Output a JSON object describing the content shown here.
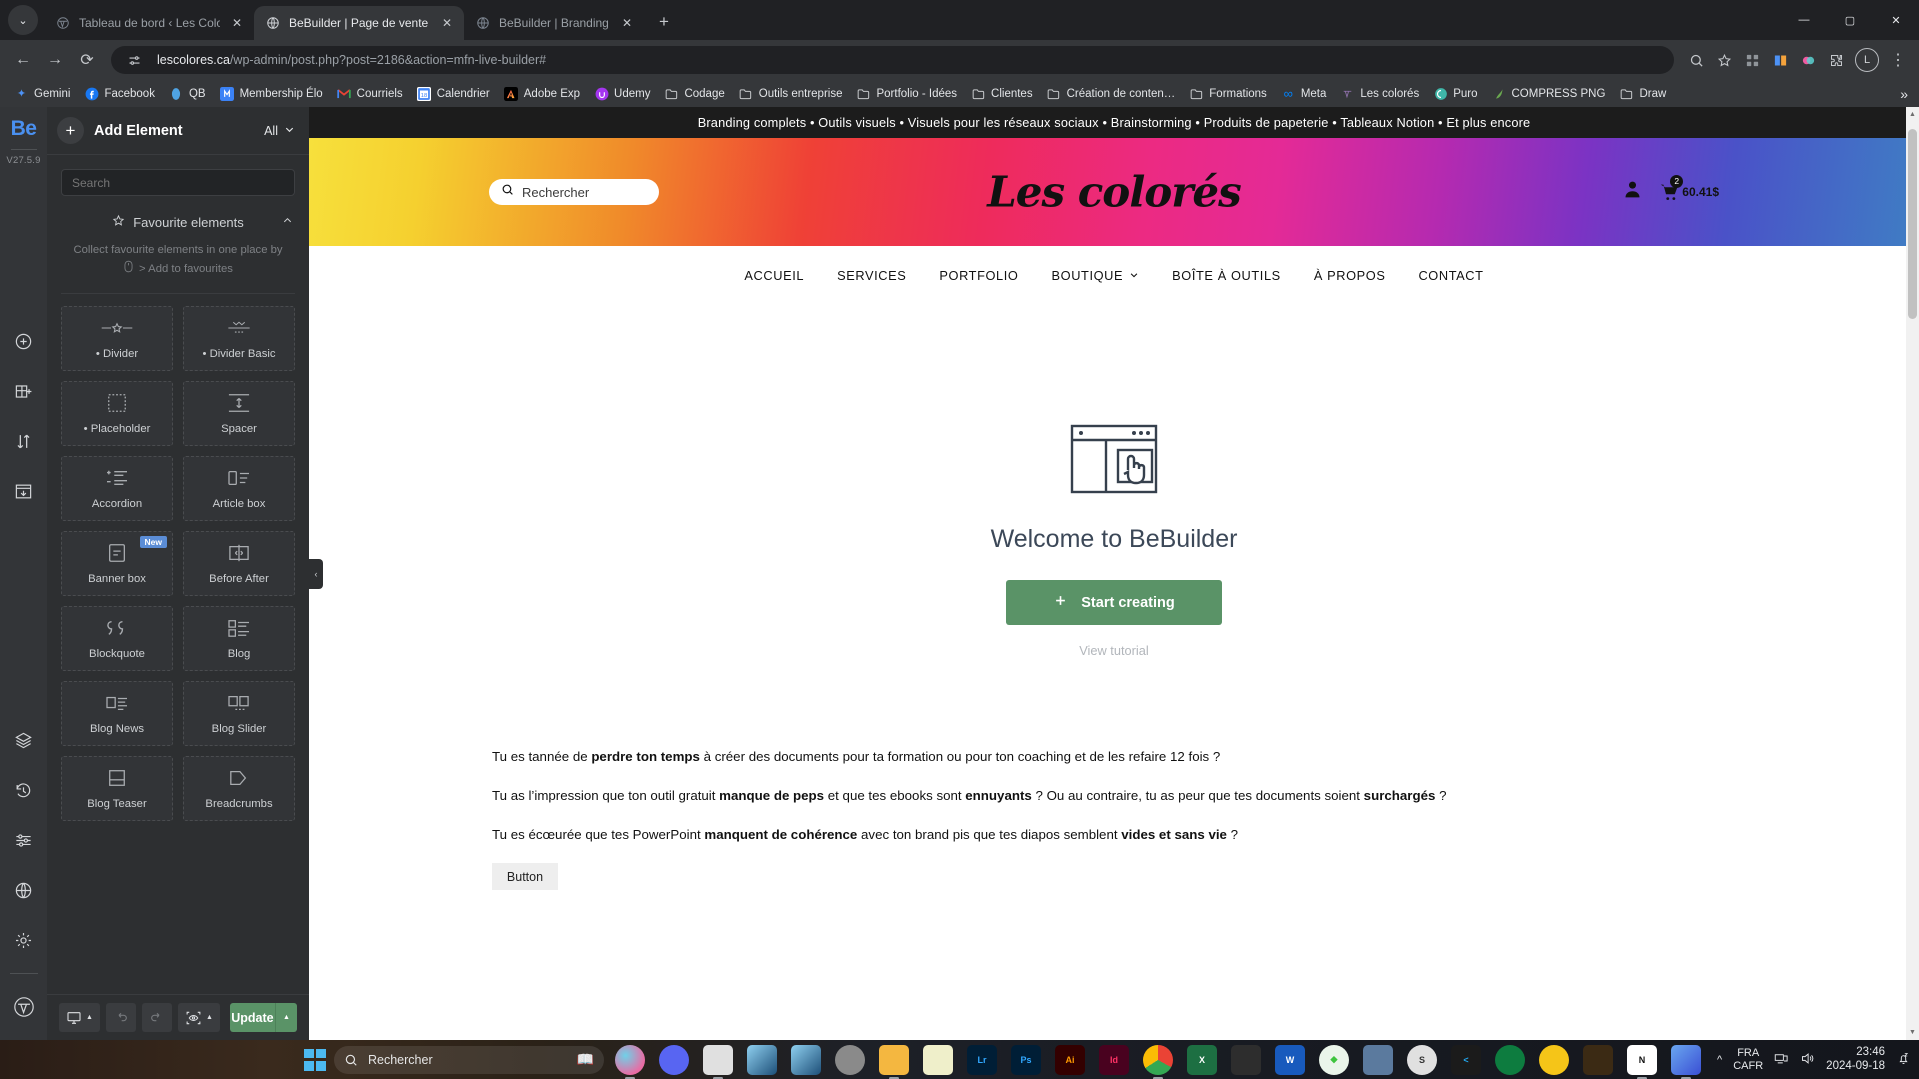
{
  "browser": {
    "tabs": [
      {
        "title": "Tableau de bord ‹ Les Colorés –",
        "favicon": "wordpress-icon",
        "active": false,
        "closable": true
      },
      {
        "title": "BeBuilder | Page de vente – Ou",
        "favicon": "globe-icon",
        "active": true,
        "closable": true
      },
      {
        "title": "BeBuilder | Branding",
        "favicon": "globe-icon",
        "active": false,
        "closable": true
      }
    ],
    "new_tab_label": "+",
    "nav": {
      "back": "←",
      "forward": "→",
      "reload": "⟳"
    },
    "url_domain": "lescolores.ca",
    "url_path": "/wp-admin/post.php?post=2186&action=mfn-live-builder#",
    "profile_initial": "L",
    "window_controls": {
      "minimize": "—",
      "maximize": "▢",
      "close": "✕"
    },
    "bookmarks": [
      {
        "label": "Gemini",
        "icon": "sparkle-icon",
        "color": "#4d92f5"
      },
      {
        "label": "Facebook",
        "icon": "facebook-icon",
        "color": "#1877f2"
      },
      {
        "label": "QB",
        "icon": "quickbooks-icon",
        "color": "#2ca01c"
      },
      {
        "label": "Membership Élo",
        "icon": "membership-icon",
        "color": "#3b82f6"
      },
      {
        "label": "Courriels",
        "icon": "gmail-icon",
        "color": "#ea4335"
      },
      {
        "label": "Calendrier",
        "icon": "calendar-icon",
        "color": "#4285f4"
      },
      {
        "label": "Adobe Exp",
        "icon": "adobe-express-icon",
        "color": "#e0334a"
      },
      {
        "label": "Udemy",
        "icon": "udemy-icon",
        "color": "#a435f0"
      },
      {
        "label": "Codage",
        "icon": "folder-icon",
        "color": "#c8cacd"
      },
      {
        "label": "Outils entreprise",
        "icon": "folder-icon",
        "color": "#c8cacd"
      },
      {
        "label": "Portfolio - Idées",
        "icon": "folder-icon",
        "color": "#c8cacd"
      },
      {
        "label": "Clientes",
        "icon": "folder-icon",
        "color": "#c8cacd"
      },
      {
        "label": "Création de conten…",
        "icon": "folder-icon",
        "color": "#c8cacd"
      },
      {
        "label": "Formations",
        "icon": "folder-icon",
        "color": "#c8cacd"
      },
      {
        "label": "Meta",
        "icon": "meta-icon",
        "color": "#0082fb"
      },
      {
        "label": "Les colorés",
        "icon": "wordpress-icon",
        "color": "#8d6fa8"
      },
      {
        "label": "Puro",
        "icon": "puro-icon",
        "color": "#3fb6a8"
      },
      {
        "label": "COMPRESS PNG",
        "icon": "compress-png-icon",
        "color": "#6aa84f"
      },
      {
        "label": "Draw",
        "icon": "folder-icon",
        "color": "#c8cacd"
      }
    ],
    "bookmarks_overflow": "»"
  },
  "builder": {
    "logo": "Be",
    "version": "V27.5.9",
    "rail_icons": [
      {
        "name": "add-section-icon"
      },
      {
        "name": "add-column-icon"
      },
      {
        "name": "reorder-icon"
      },
      {
        "name": "import-template-icon"
      },
      {
        "name": "layers-icon"
      },
      {
        "name": "history-icon"
      },
      {
        "name": "settings-sliders-icon"
      },
      {
        "name": "globe-icon"
      },
      {
        "name": "gear-icon"
      },
      {
        "name": "wordpress-icon"
      }
    ],
    "panel": {
      "title": "Add Element",
      "filter_label": "All",
      "search_placeholder": "Search",
      "favourites_title": "Favourite elements",
      "favourites_desc_line1": "Collect favourite elements in one place by",
      "favourites_desc_line2": "> Add to favourites",
      "elements": [
        {
          "label": "• Divider",
          "icon": "divider-icon",
          "new": false
        },
        {
          "label": "• Divider Basic",
          "icon": "divider-basic-icon",
          "new": false
        },
        {
          "label": "• Placeholder",
          "icon": "placeholder-icon",
          "new": false
        },
        {
          "label": "Spacer",
          "icon": "spacer-icon",
          "new": false
        },
        {
          "label": "Accordion",
          "icon": "accordion-icon",
          "new": false
        },
        {
          "label": "Article box",
          "icon": "article-box-icon",
          "new": false
        },
        {
          "label": "Banner box",
          "icon": "banner-box-icon",
          "new": true,
          "badge": "New"
        },
        {
          "label": "Before After",
          "icon": "before-after-icon",
          "new": false
        },
        {
          "label": "Blockquote",
          "icon": "blockquote-icon",
          "new": false
        },
        {
          "label": "Blog",
          "icon": "blog-icon",
          "new": false
        },
        {
          "label": "Blog News",
          "icon": "blog-news-icon",
          "new": false
        },
        {
          "label": "Blog Slider",
          "icon": "blog-slider-icon",
          "new": false
        },
        {
          "label": "Blog Teaser",
          "icon": "blog-teaser-icon",
          "new": false
        },
        {
          "label": "Breadcrumbs",
          "icon": "breadcrumbs-icon",
          "new": false
        }
      ]
    },
    "footer": {
      "responsive_label": "desktop-view-icon",
      "undo_label": "undo-icon",
      "redo_label": "redo-icon",
      "preview_label": "preview-icon",
      "update_label": "Update",
      "update_arrow": "▲"
    },
    "collapse_arrow": "‹"
  },
  "site": {
    "announcement": "Branding complets • Outils visuels • Visuels pour les réseaux sociaux • Brainstorming • Produits de papeterie • Tableaux Notion • Et plus encore",
    "search_placeholder": "Rechercher",
    "brand": "Les colorés",
    "cart_count": "2",
    "cart_total": "60.41$",
    "nav": [
      {
        "label": "ACCUEIL",
        "has_dropdown": false
      },
      {
        "label": "SERVICES",
        "has_dropdown": false
      },
      {
        "label": "PORTFOLIO",
        "has_dropdown": false
      },
      {
        "label": "BOUTIQUE",
        "has_dropdown": true
      },
      {
        "label": "BOÎTE À OUTILS",
        "has_dropdown": false
      },
      {
        "label": "À PROPOS",
        "has_dropdown": false
      },
      {
        "label": "CONTACT",
        "has_dropdown": false
      }
    ],
    "welcome": {
      "heading": "Welcome to BeBuilder",
      "start_button": "Start creating",
      "start_icon": "plus-icon",
      "tutorial_link": "View tutorial"
    },
    "copy": [
      {
        "parts": [
          {
            "t": "Tu es tannée de ",
            "b": false
          },
          {
            "t": "perdre ton temps",
            "b": true
          },
          {
            "t": " à créer des documents pour ta formation ou pour ton coaching et de les refaire 12 fois ?",
            "b": false
          }
        ]
      },
      {
        "parts": [
          {
            "t": "Tu as l’impression que ton outil gratuit ",
            "b": false
          },
          {
            "t": "manque de peps",
            "b": true
          },
          {
            "t": " et que tes ebooks sont ",
            "b": false
          },
          {
            "t": "ennuyants",
            "b": true
          },
          {
            "t": " ? Ou au contraire, tu as peur que tes documents soient ",
            "b": false
          },
          {
            "t": "surchargés",
            "b": true
          },
          {
            "t": " ?",
            "b": false
          }
        ]
      },
      {
        "parts": [
          {
            "t": "Tu es écœurée que tes PowerPoint ",
            "b": false
          },
          {
            "t": "manquent de cohérence",
            "b": true
          },
          {
            "t": " avec ton brand pis que tes diapos semblent ",
            "b": false
          },
          {
            "t": "vides et sans vie",
            "b": true
          },
          {
            "t": " ?",
            "b": false
          }
        ]
      }
    ],
    "button_element_label": "Button",
    "accent_green": "#5a9367"
  },
  "taskbar": {
    "search_placeholder": "Rechercher",
    "apps": [
      {
        "name": "copilot-icon",
        "color": "#e86ca4"
      },
      {
        "name": "discord-icon",
        "color": "#5865f2"
      },
      {
        "name": "snipping-tool-icon",
        "color": "#d8d8d8"
      },
      {
        "name": "krita-icon",
        "color": "#2a6fa8"
      },
      {
        "name": "krita2-icon",
        "color": "#2a6fa8"
      },
      {
        "name": "settings-icon",
        "color": "#8a8a8a"
      },
      {
        "name": "explorer-icon",
        "color": "#f4b740"
      },
      {
        "name": "flask-icon",
        "color": "#e7e7b0"
      },
      {
        "name": "lightroom-icon",
        "color": "#001e36",
        "label": "Lr"
      },
      {
        "name": "photoshop-icon",
        "color": "#001e36",
        "label": "Ps"
      },
      {
        "name": "illustrator-icon",
        "color": "#330000",
        "label": "Ai"
      },
      {
        "name": "indesign-icon",
        "color": "#49021f",
        "label": "Id"
      },
      {
        "name": "chrome-icon",
        "color": "#ffffff"
      },
      {
        "name": "excel-icon",
        "color": "#1d6f42",
        "label": "X"
      },
      {
        "name": "affinity-icon",
        "color": "#2d2d2d"
      },
      {
        "name": "word-icon",
        "color": "#185abd",
        "label": "W"
      },
      {
        "name": "sims-icon",
        "color": "#e8f3e8"
      },
      {
        "name": "cities-skylines-icon",
        "color": "#5b7a9e"
      },
      {
        "name": "steam-icon",
        "color": "#e0e0e0"
      },
      {
        "name": "vscode-icon",
        "color": "#23a9f2"
      },
      {
        "name": "evernote-icon",
        "color": "#0d7c3f"
      },
      {
        "name": "thunderbird-icon",
        "color": "#f5c518"
      },
      {
        "name": "jurassic-icon",
        "color": "#3b2a14"
      },
      {
        "name": "notion-icon",
        "color": "#ffffff",
        "label": "N"
      },
      {
        "name": "photos-icon",
        "color": "#4a6fd4"
      }
    ],
    "tray": {
      "chevron": "^",
      "lang_line1": "FRA",
      "lang_line2": "CAFR",
      "network_icon": "network-icon",
      "volume_icon": "volume-icon",
      "time": "23:46",
      "date": "2024-09-18",
      "notification_icon": "bell-sleep-icon"
    }
  }
}
